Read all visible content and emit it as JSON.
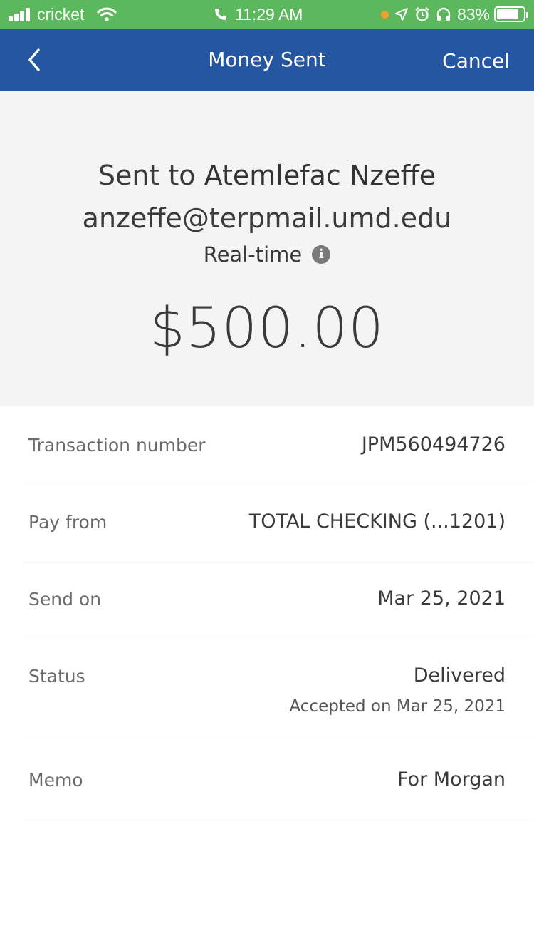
{
  "status_bar": {
    "carrier": "cricket",
    "time": "11:29 AM",
    "battery_percent": "83%",
    "battery_level": 0.83,
    "colors": {
      "background": "#5cb85c"
    },
    "icons": [
      "signal-icon",
      "wifi-icon",
      "phone-icon",
      "location-icon",
      "alarm-icon",
      "headphones-icon",
      "battery-charging-icon"
    ]
  },
  "nav": {
    "back_icon": "chevron-left-icon",
    "title": "Money Sent",
    "cancel_label": "Cancel",
    "colors": {
      "background": "#2556a2"
    }
  },
  "hero": {
    "sent_to_prefix": "Sent to",
    "recipient_name": "Atemlefac Nzeffe",
    "email": "anzeffe@terpmail.umd.edu",
    "speed_label": "Real-time",
    "amount": "$500.00"
  },
  "details": {
    "transaction_number": {
      "label": "Transaction number",
      "value": "JPM560494726"
    },
    "pay_from": {
      "label": "Pay from",
      "value": "TOTAL CHECKING (...1201)"
    },
    "send_on": {
      "label": "Send on",
      "value": "Mar 25, 2021"
    },
    "status": {
      "label": "Status",
      "value": "Delivered",
      "sub": "Accepted on Mar 25, 2021"
    },
    "memo": {
      "label": "Memo",
      "value": "For Morgan"
    }
  }
}
